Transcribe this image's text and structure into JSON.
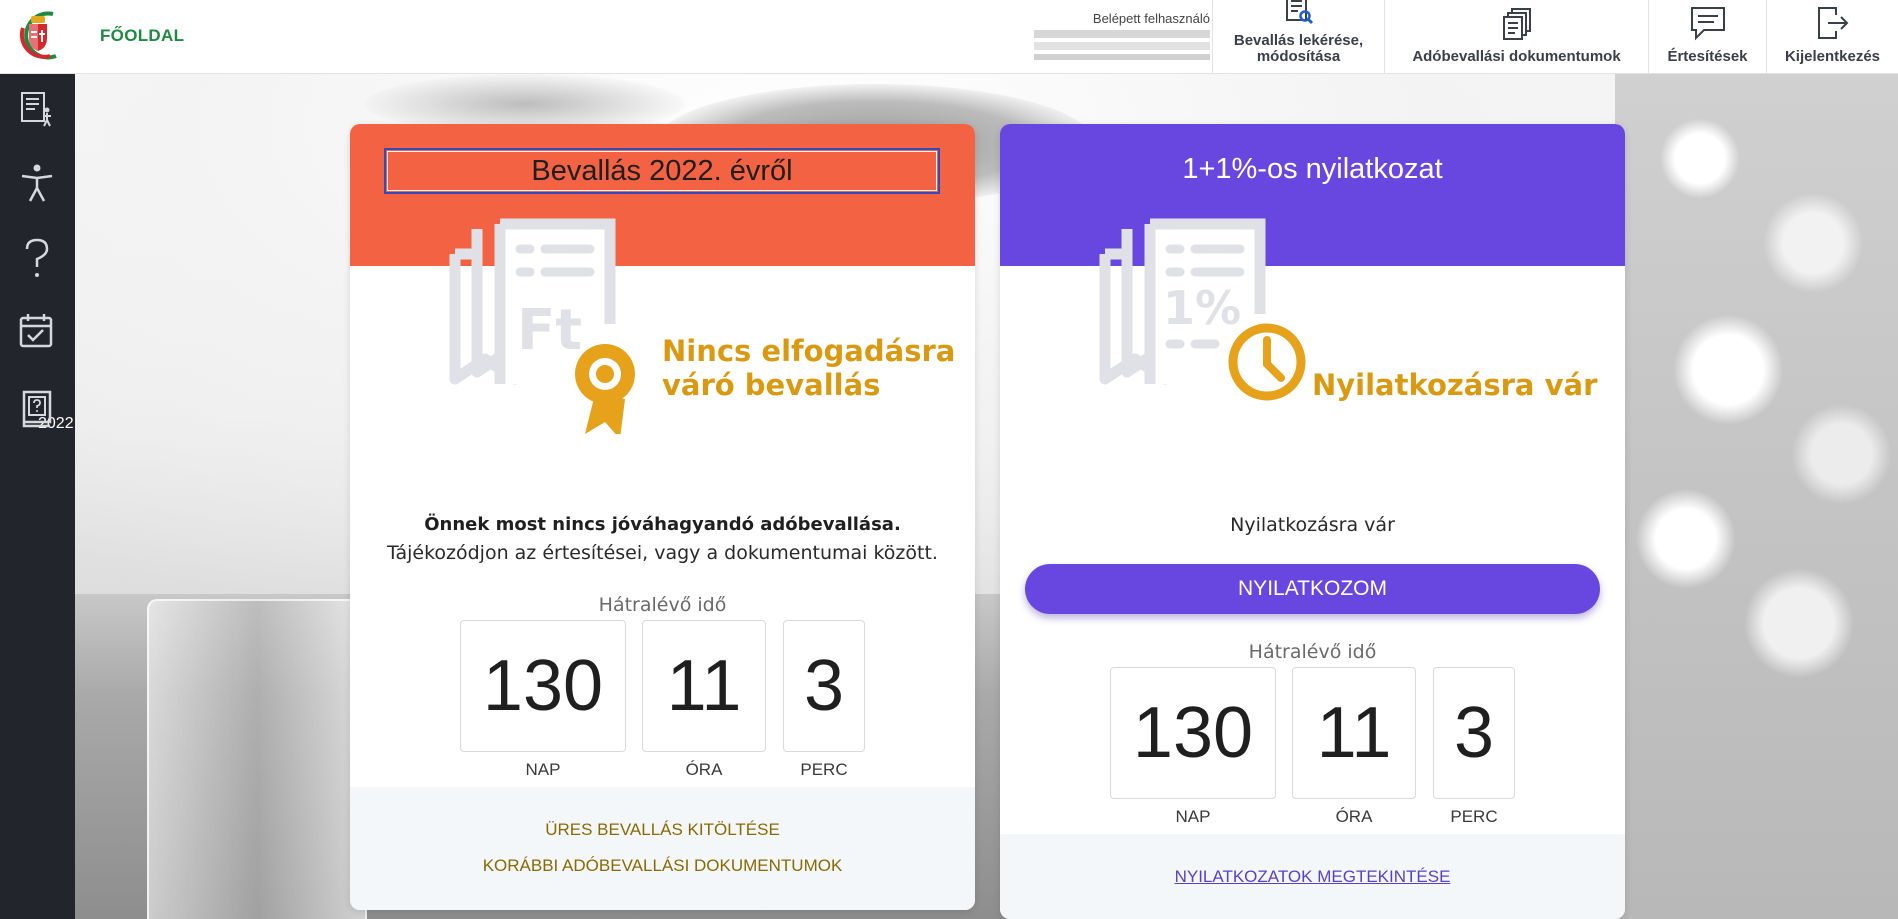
{
  "header": {
    "home_label": "FŐOLDAL",
    "user_label": "Belépett felhasználó",
    "nav": [
      {
        "label_line1": "Bevallás lekérése,",
        "label_line2": "módosítása",
        "icon": "document-search-icon"
      },
      {
        "label": "Adóbevallási dokumentumok",
        "icon": "documents-stack-icon"
      },
      {
        "label": "Értesítések",
        "icon": "message-icon"
      },
      {
        "label": "Kijelentkezés",
        "icon": "logout-icon"
      }
    ]
  },
  "sidebar": {
    "items": [
      {
        "icon": "form-person-icon"
      },
      {
        "icon": "accessibility-icon"
      },
      {
        "icon": "help-question-icon"
      },
      {
        "icon": "calendar-check-icon",
        "year": "2022"
      },
      {
        "icon": "book-question-icon"
      }
    ]
  },
  "left_card": {
    "title": "Bevallás 2022. évről",
    "status_line1": "Nincs elfogadásra",
    "status_line2": "váró bevallás",
    "info_bold": "Önnek most nincs jóváhagyandó adóbevallása.",
    "info_plain": "Tájékozódjon az értesítései, vagy a dokumentumai között.",
    "remaining_label": "Hátralévő idő",
    "countdown": [
      {
        "value": "130",
        "unit": "NAP"
      },
      {
        "value": "11",
        "unit": "ÓRA"
      },
      {
        "value": "3",
        "unit": "PERC"
      }
    ],
    "links": [
      "ÜRES BEVALLÁS KITÖLTÉSE",
      "KORÁBBI ADÓBEVALLÁSI DOKUMENTUMOK"
    ],
    "colors": {
      "head": "#f36242",
      "status": "#d99a12"
    }
  },
  "right_card": {
    "title": "1+1%-os nyilatkozat",
    "status": "Nyilatkozásra vár",
    "status_small": "Nyilatkozásra vár",
    "cta": "NYILATKOZOM",
    "remaining_label": "Hátralévő idő",
    "countdown": [
      {
        "value": "130",
        "unit": "NAP"
      },
      {
        "value": "11",
        "unit": "ÓRA"
      },
      {
        "value": "3",
        "unit": "PERC"
      }
    ],
    "link": "NYILATKOZATOK MEGTEKINTÉSE",
    "colors": {
      "head": "#6847e0",
      "status": "#d99a12"
    }
  }
}
